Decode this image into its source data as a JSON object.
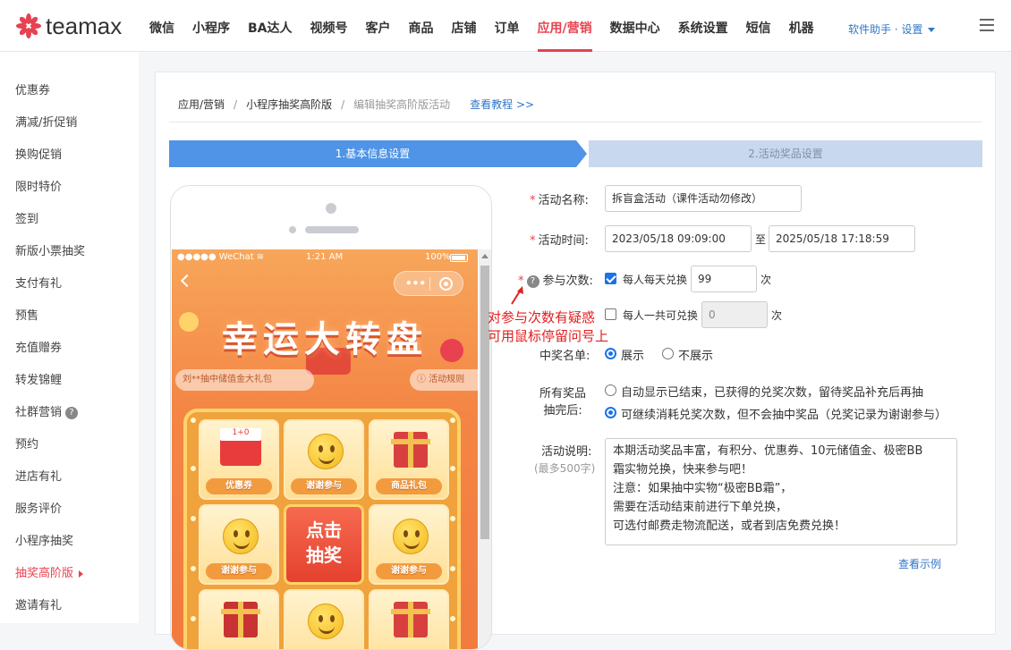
{
  "brand": {
    "name": "teamax",
    "accent": "#e8414f",
    "link": "#2f76c9"
  },
  "nav": {
    "items": [
      "微信",
      "小程序",
      "BA达人",
      "视频号",
      "客户",
      "商品",
      "店铺",
      "订单",
      "应用/营销",
      "数据中心",
      "系统设置",
      "短信",
      "机器"
    ],
    "active": "应用/营销",
    "helper": "软件助手 · 设置"
  },
  "sidebar": {
    "items": [
      "优惠券",
      "满减/折促销",
      "换购促销",
      "限时特价",
      "签到",
      "新版小票抽奖",
      "支付有礼",
      "预售",
      "充值赠券",
      "转发锦鲤",
      "社群营销",
      "预约",
      "进店有礼",
      "服务评价",
      "小程序抽奖",
      "抽奖高阶版",
      "邀请有礼"
    ],
    "active": "抽奖高阶版",
    "help_mark": "?"
  },
  "breadcrumb": {
    "items": [
      "应用/营销",
      "小程序抽奖高阶版",
      "编辑抽奖高阶版活动"
    ],
    "separator": "/",
    "tutorial": "查看教程 >>"
  },
  "steps": [
    "1.基本信息设置",
    "2.活动奖品设置"
  ],
  "preview": {
    "status_left": "●●●●● WeChat ≋",
    "status_time": "1:21 AM",
    "status_battery": "100%",
    "capsule_dots": "•••",
    "title": "幸运大转盘",
    "notice": "刘**抽中储值金大礼包",
    "rules": "ⓘ 活动规则",
    "cells": [
      {
        "label": "优惠券",
        "icon": "coupon-icon"
      },
      {
        "label": "谢谢参与",
        "icon": "smiley-icon"
      },
      {
        "label": "商品礼包",
        "icon": "gift-icon"
      },
      {
        "label": "谢谢参与",
        "icon": "smiley-icon"
      },
      {
        "label": "谢谢参与",
        "icon": "smiley-icon"
      }
    ],
    "center_button": [
      "点击",
      "抽奖"
    ]
  },
  "form": {
    "name_label": "活动名称:",
    "name_value": "拆盲盒活动（课件活动勿修改）",
    "time_label": "活动时间:",
    "time_start": "2023/05/18 09:09:00",
    "time_to": "至",
    "time_end": "2025/05/18 17:18:59",
    "times_label": "参与次数:",
    "daily_label": "每人每天兑换",
    "daily_checked": true,
    "daily_value": "99",
    "unit": "次",
    "total_label": "每人一共可兑换",
    "total_checked": false,
    "total_value": "0",
    "winners_label": "中奖名单:",
    "show_label": "展示",
    "hide_label": "不展示",
    "winners_selected": "展示",
    "after_label_1": "所有奖品",
    "after_label_2": "抽完后:",
    "after_opt1": "自动显示已结束，已获得的兑奖次数，留待奖品补充后再抽",
    "after_opt2": "可继续消耗兑奖次数，但不会抽中奖品（兑奖记录为谢谢参与）",
    "after_selected": 2,
    "desc_label": "活动说明:",
    "desc_limit": "(最多500字)",
    "desc_lines": [
      "本期活动奖品丰富，有积分、优惠券、10元储值金、极密BB",
      "霜实物兑换，快来参与吧！",
      "注意：如果抽中实物“极密BB霜”，",
      "需要在活动结束前进行下单兑换，",
      "可选付邮费走物流配送，或者到店免费兑换！"
    ],
    "example_link": "查看示例",
    "required_mark": "*",
    "help_mark": "?"
  },
  "annotation": {
    "line1": "对参与次数有疑惑",
    "line2": "可用鼠标停留问号上",
    "color": "#e02020"
  }
}
